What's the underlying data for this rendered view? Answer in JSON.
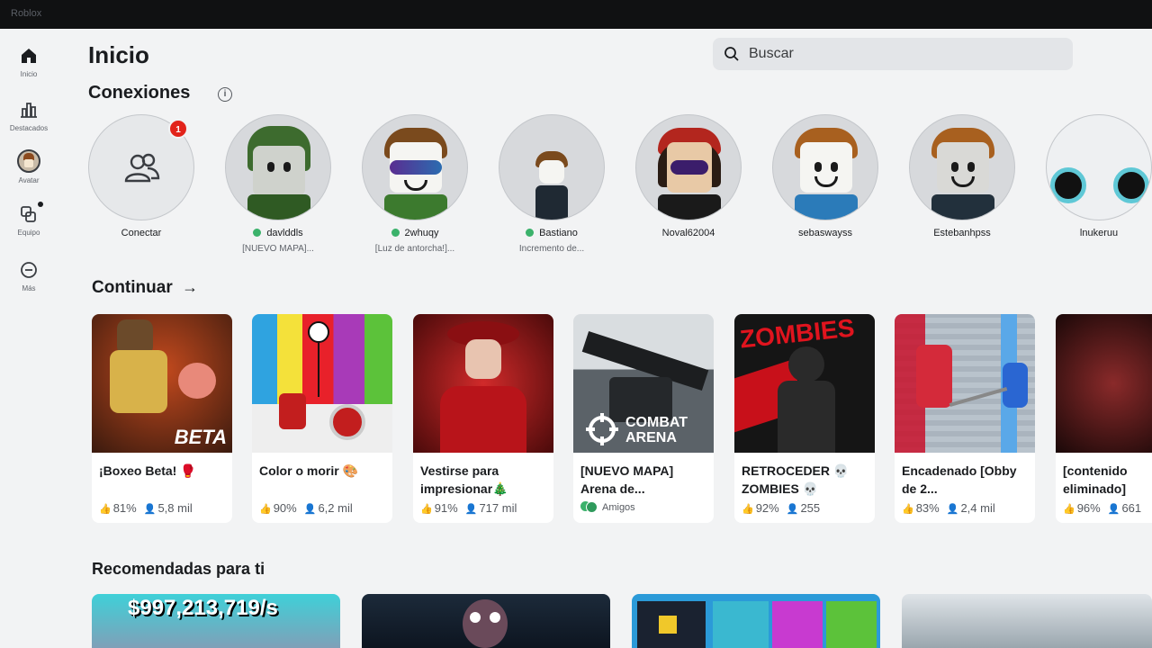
{
  "window": {
    "title": "Roblox"
  },
  "nav": [
    {
      "label": "Inicio",
      "icon": "home-icon"
    },
    {
      "label": "Destacados",
      "icon": "chart-icon"
    },
    {
      "label": "Avatar",
      "icon": "avatar-icon"
    },
    {
      "label": "Equipo",
      "icon": "team-icon"
    },
    {
      "label": "Más",
      "icon": "more-icon"
    }
  ],
  "header": {
    "title": "Inicio",
    "search_placeholder": "Buscar"
  },
  "connections": {
    "title": "Conexiones",
    "add": {
      "label": "Conectar",
      "badge": "1"
    },
    "friends": [
      {
        "name": "davlddls",
        "online": true,
        "status": "[NUEVO MAPA]..."
      },
      {
        "name": "2whuqy",
        "online": true,
        "status": "[Luz de antorcha!]..."
      },
      {
        "name": "Bastiano",
        "online": true,
        "status": "Incremento de..."
      },
      {
        "name": "Noval62004",
        "online": false,
        "status": ""
      },
      {
        "name": "sebaswayss",
        "online": false,
        "status": ""
      },
      {
        "name": "Estebanhpss",
        "online": false,
        "status": ""
      },
      {
        "name": "lnukeruu",
        "online": false,
        "status": ""
      }
    ]
  },
  "continue": {
    "title": "Continuar",
    "games": [
      {
        "title": "¡Boxeo Beta! 🥊",
        "rating": "81%",
        "players": "5,8 mil",
        "thumb_label": "BETA"
      },
      {
        "title": "Color o morir 🎨",
        "rating": "90%",
        "players": "6,2 mil",
        "thumb_label": ""
      },
      {
        "title": "Vestirse para impresionar🎄",
        "rating": "91%",
        "players": "717 mil",
        "thumb_label": ""
      },
      {
        "title": "[NUEVO MAPA] Arena de...",
        "friends_label": "Amigos",
        "thumb_label": "COMBAT ARENA"
      },
      {
        "title": "RETROCEDER 💀 ZOMBIES 💀",
        "rating": "92%",
        "players": "255",
        "thumb_label": "ZOMBIES"
      },
      {
        "title": "Encadenado [Obby de 2...",
        "rating": "83%",
        "players": "2,4 mil",
        "thumb_label": ""
      },
      {
        "title": "[contenido eliminado]",
        "rating": "96%",
        "players": "661",
        "thumb_label": ""
      }
    ]
  },
  "recommended": {
    "title": "Recomendadas para ti",
    "items": [
      {
        "banner": "$997,213,719/s"
      },
      {
        "banner": ""
      },
      {
        "banner": ""
      },
      {
        "banner": ""
      }
    ]
  }
}
